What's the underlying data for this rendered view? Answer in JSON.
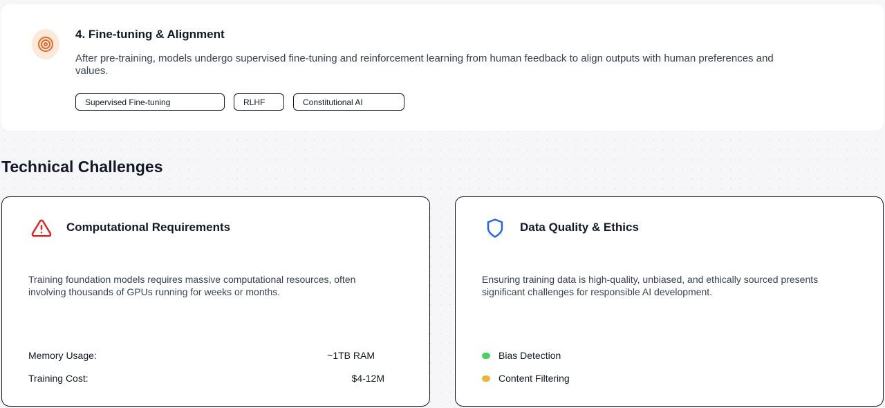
{
  "stage": {
    "title": "4. Fine-tuning & Alignment",
    "description": "After pre-training, models undergo supervised fine-tuning and reinforcement learning from human feedback to align outputs with human preferences and values.",
    "icon": "target-icon",
    "accent_color": "#e46a2b",
    "tags": [
      {
        "label": "Supervised Fine-tuning"
      },
      {
        "label": "RLHF"
      },
      {
        "label": "Constitutional AI"
      }
    ]
  },
  "section": {
    "title": "Technical Challenges"
  },
  "challenges": [
    {
      "title": "Computational Requirements",
      "icon": "warning-triangle-icon",
      "icon_color": "#dc2626",
      "description": "Training foundation models requires massive computational resources, often involving thousands of GPUs running for weeks or months.",
      "metrics": [
        {
          "label": "Memory Usage:",
          "value": "~1TB RAM"
        },
        {
          "label": "Training Cost:",
          "value": "$4-12M"
        }
      ]
    },
    {
      "title": "Data Quality & Ethics",
      "icon": "shield-icon",
      "icon_color": "#2563eb",
      "description": "Ensuring training data is high-quality, unbiased, and ethically sourced presents significant challenges for responsible AI development.",
      "features": [
        {
          "label": "Bias Detection",
          "color": "#4ccf5e"
        },
        {
          "label": "Content Filtering",
          "color": "#e9b53f"
        }
      ]
    }
  ]
}
